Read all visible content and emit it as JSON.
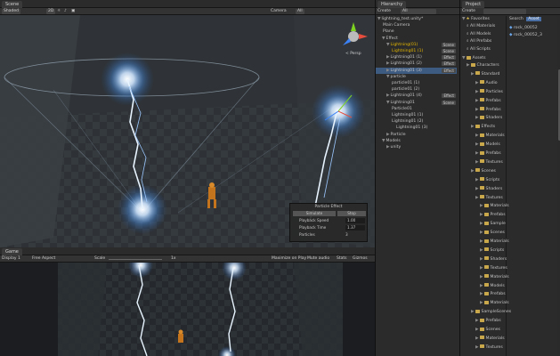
{
  "scene": {
    "tab": "Scene",
    "shading": "Shaded",
    "mode_2d": "2D",
    "camera": "Camera",
    "all": "All",
    "gizmo_label": "< Persp",
    "effect_panel": {
      "title": "Particle Effect",
      "buttons": [
        "Simulate",
        "Stop"
      ],
      "rows": [
        {
          "label": "Playback Speed",
          "value": "1.00"
        },
        {
          "label": "Playback Time",
          "value": "1.37"
        },
        {
          "label": "Particles",
          "value": "3"
        }
      ]
    }
  },
  "game": {
    "tab": "Game",
    "display": "Display 1",
    "aspect": "Free Aspect",
    "scale": "Scale",
    "scale_value": "1x",
    "right_items": [
      "Maximize on Play",
      "Mute audio",
      "Stats",
      "Gizmos"
    ]
  },
  "hierarchy": {
    "tab": "Hierarchy",
    "create": "Create",
    "all": "All",
    "items": [
      {
        "text": "lightning_test.unity*",
        "indent": 0,
        "arrow": "▼",
        "style": "normal"
      },
      {
        "text": "Main Camera",
        "indent": 1,
        "arrow": "",
        "style": "normal"
      },
      {
        "text": "Plane",
        "indent": 1,
        "arrow": "",
        "style": "normal"
      },
      {
        "text": "Effect",
        "indent": 1,
        "arrow": "▼",
        "style": "normal"
      },
      {
        "text": "Lightning(01)",
        "indent": 2,
        "arrow": "▼",
        "style": "warn",
        "tag": "Scene"
      },
      {
        "text": "Lightning01 (1)",
        "indent": 3,
        "arrow": "",
        "style": "warn",
        "tag": "Scene"
      },
      {
        "text": "Lightning01 (1)",
        "indent": 2,
        "arrow": "▶",
        "style": "normal",
        "tag": "Effect"
      },
      {
        "text": "Lightning01 (2)",
        "indent": 2,
        "arrow": "▶",
        "style": "normal",
        "tag": "Effect"
      },
      {
        "text": "Lightning01 (3)",
        "indent": 2,
        "arrow": "▶",
        "style": "sel",
        "tag": "Effect"
      },
      {
        "text": "particle",
        "indent": 2,
        "arrow": "▼",
        "style": "normal"
      },
      {
        "text": "particle01 (1)",
        "indent": 3,
        "arrow": "",
        "style": "normal"
      },
      {
        "text": "particle01 (2)",
        "indent": 3,
        "arrow": "",
        "style": "normal"
      },
      {
        "text": "Lightning01 (4)",
        "indent": 2,
        "arrow": "▶",
        "style": "normal",
        "tag": "Effect"
      },
      {
        "text": "Lightning01",
        "indent": 2,
        "arrow": "▼",
        "style": "normal",
        "tag": "Scene"
      },
      {
        "text": "Particle01",
        "indent": 3,
        "arrow": "",
        "style": "normal"
      },
      {
        "text": "Lightning01 (1)",
        "indent": 3,
        "arrow": "",
        "style": "normal"
      },
      {
        "text": "Lightning01 (2)",
        "indent": 3,
        "arrow": "",
        "style": "normal"
      },
      {
        "text": "Lightning01 (3)",
        "indent": 4,
        "arrow": "",
        "style": "normal"
      },
      {
        "text": "Particle",
        "indent": 2,
        "arrow": "▶",
        "style": "normal"
      },
      {
        "text": "Models",
        "indent": 1,
        "arrow": "▼",
        "style": "normal"
      },
      {
        "text": "unity",
        "indent": 2,
        "arrow": "▶",
        "style": "normal"
      }
    ]
  },
  "project": {
    "tab": "Project",
    "create": "Create",
    "search_tag": "Search",
    "scope_all": "Asset",
    "favorites_label": "Favorites",
    "favorites": [
      "All Materials",
      "All Models",
      "All Prefabs",
      "All Scripts"
    ],
    "assets_label": "Assets",
    "tree": [
      "Characters",
      "Standard",
      "Audio",
      "Particles",
      "Prefabs",
      "Prefabs",
      "Shaders",
      "Effects",
      "Materials",
      "Models",
      "Prefabs",
      "Textures",
      "Scenes",
      "Scripts",
      "Shaders",
      "Textures",
      "Materials",
      "Prefabs",
      "Sample",
      "Scenes",
      "Materials",
      "Scripts",
      "Shaders",
      "Textures",
      "Materials",
      "Models",
      "Prefabs",
      "Materials",
      "SampleScenes",
      "Prefabs",
      "Scenes",
      "Materials",
      "Textures"
    ],
    "files": [
      "rock_00052",
      "rock_00052_3"
    ]
  }
}
